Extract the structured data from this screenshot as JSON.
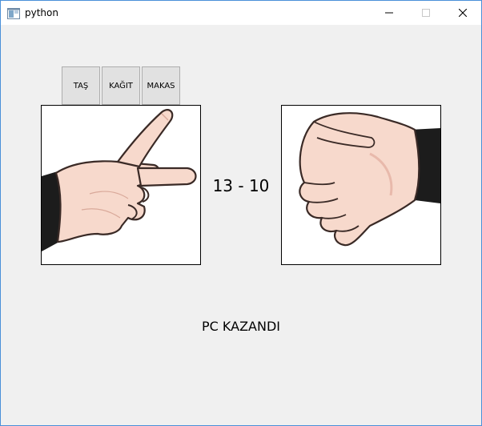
{
  "window": {
    "title": "python"
  },
  "controls": {
    "rock_label": "TAŞ",
    "paper_label": "KAĞIT",
    "scissors_label": "MAKAS"
  },
  "game": {
    "score": "13 - 10",
    "result": "PC KAZANDI",
    "player_choice_icon": "scissors-hand-icon",
    "pc_choice_icon": "rock-fist-icon"
  },
  "colors": {
    "skin": "#f7d9cc",
    "sleeve": "#1c1c1c",
    "outline": "#3a2a26"
  }
}
